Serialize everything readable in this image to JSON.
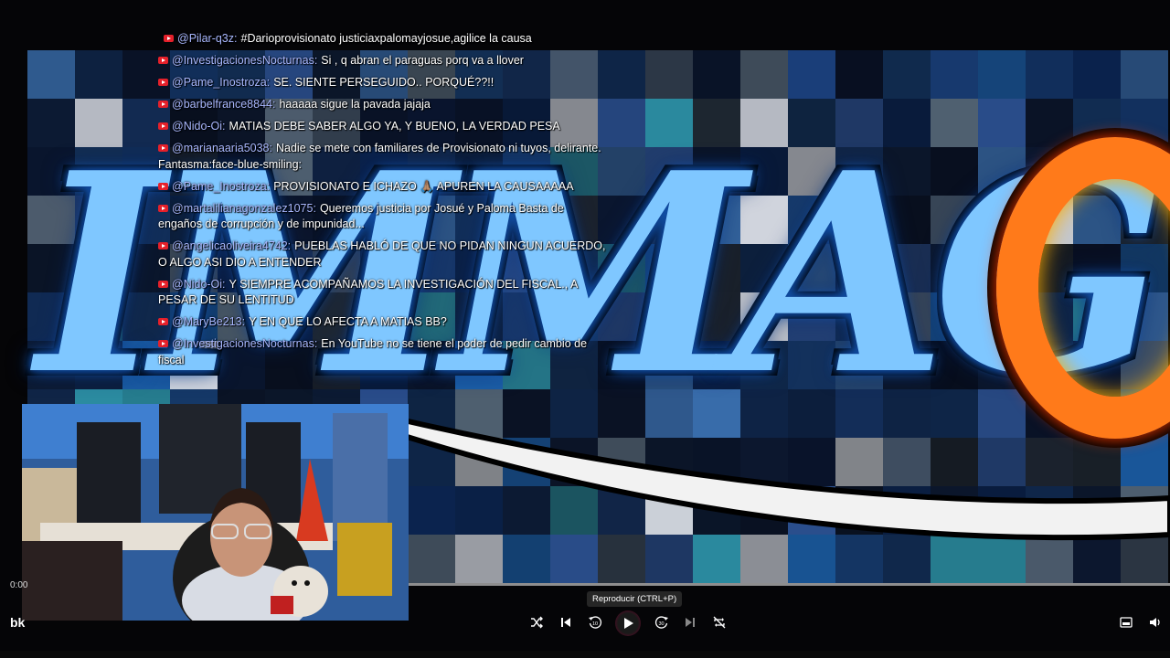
{
  "chat": {
    "messages": [
      {
        "user": "@Pilar-q3z:",
        "text": "#Darioprovisionato justiciaxpalomayjosue,agilice la causa"
      },
      {
        "user": "@InvestigacionesNocturnas:",
        "text": "Si , q abran el paraguas porq va a llover"
      },
      {
        "user": "@Pame_Inostroza:",
        "text": "SE. SIENTE PERSEGUIDO.. PORQUÉ??!!"
      },
      {
        "user": "@barbelfrance8844:",
        "text": "haaaaa sigue la pavada jajaja"
      },
      {
        "user": "@Nido-Oi:",
        "text": "MATIAS DEBE SABER ALGO YA, Y BUENO, LA VERDAD PESA"
      },
      {
        "user": "@marianaaria5038:",
        "text": "Nadie se mete con familiares de Provisionato ni tuyos, delirante. Fantasma:face-blue-smiling:"
      },
      {
        "user": "@Pame_Inostroza:",
        "text": "PROVISIONATO E ICHAZO 🙏🏽 APUREN LA CAUSAAAAA"
      },
      {
        "user": "@martalilianagonzalez1075:",
        "text": "Queremos justicia por Josué y Paloma Basta de engaños de corrupción y de impunidad..."
      },
      {
        "user": "@angelicaoliveira4742:",
        "text": "PUEBLAS HABLÓ DE QUE NO PIDAN NINGUN ACUERDO, O ALGO ASI DIO A ENTENDER"
      },
      {
        "user": "@Nido-Oi:",
        "text": "Y SIEMPRE ACOMPAÑAMOS LA INVESTIGACIÓN DEL FISCAL., A PESAR DE SU LENTITUD"
      },
      {
        "user": "@MaryBe213:",
        "text": "Y EN QUE LO AFECTA A MATIAS BB?"
      },
      {
        "user": "@InvestigacionesNocturnas:",
        "text": "En YouTube no se tiene el poder de pedir cambio de fiscal"
      }
    ]
  },
  "logo": {
    "text": "IMMAG"
  },
  "player": {
    "time": "0:00",
    "channel_short": "bk",
    "tooltip": "Reproducir (CTRL+P)",
    "progress": 0.0,
    "icons": [
      "shuffle-icon",
      "previous-icon",
      "rewind-10-icon",
      "play-icon",
      "forward-30-icon",
      "next-icon",
      "repeat-off-icon",
      "miniplayer-icon",
      "volume-icon"
    ]
  },
  "colors": {
    "accent_red": "#e5202a",
    "username": "#a9b8ff",
    "logo_blue": "#7fc7ff",
    "logo_fire": "#ff7a1a"
  }
}
